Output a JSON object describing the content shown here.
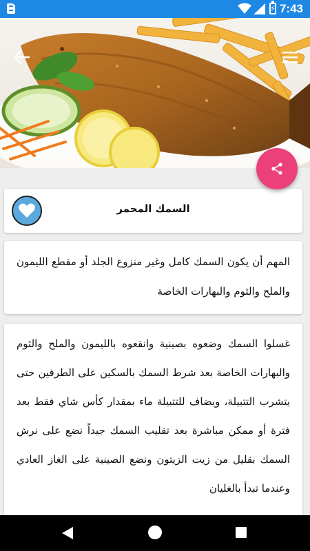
{
  "status_bar": {
    "time": "7:43",
    "icons": [
      "sd-card-icon",
      "wifi-icon",
      "signal-icon",
      "battery-charging-icon"
    ]
  },
  "hero": {
    "image": "fried-fish-with-fries-lemon-salad",
    "icons": {
      "back": "back-arrow-icon",
      "menu": "hamburger-menu-icon"
    }
  },
  "share_button": {
    "icon": "share-icon",
    "color": "#ec407a"
  },
  "recipe": {
    "title": "السمك المحمر",
    "favorite_icon": "heart-icon",
    "ingredients": "المهم أن يكون السمك كامل وغير منزوع الجلد أو مقطع الليمون والملح والثوم والبهارات الخاصة",
    "steps": "غسلوا السمك وضعوه بصينية وانقعوه بالليمون والملح والثوم والبهارات الخاصة بعد شرط السمك بالسكين على الطرفين حتى يتشرب التتبيلة، ويضاف للتتبيلة ماء بمقدار كأس شاي فقط بعد فترة أو ممكن مباشرة بعد تقليب السمك جيداً نضع على نرش السمك بقليل من زيت الزيتون ونضع الصينية على الغاز العادي وعندما تبدأ بالغليان"
  },
  "colors": {
    "status_bar": "#1e88e5",
    "accent": "#ec407a",
    "heart": "#5ba8dc",
    "background": "#eeeeee"
  },
  "nav_bar": {
    "icons": [
      "nav-back-icon",
      "nav-home-icon",
      "nav-recents-icon"
    ]
  }
}
